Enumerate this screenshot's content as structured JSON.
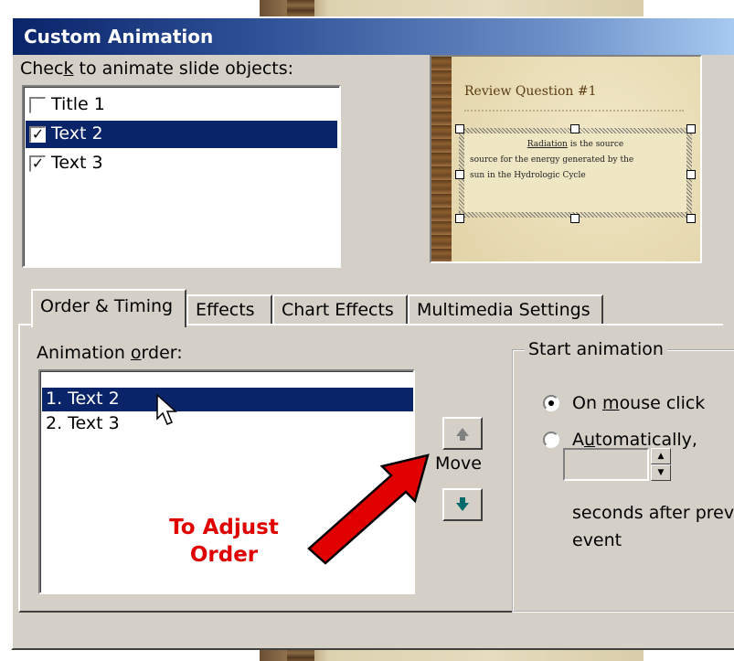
{
  "dialog": {
    "title": "Custom Animation",
    "objects_label_pre": "Chec",
    "objects_label_key": "k",
    "objects_label_post": " to animate slide objects:",
    "objects": [
      {
        "label": "Title 1",
        "checked": false,
        "selected": false
      },
      {
        "label": "Text 2",
        "checked": true,
        "selected": true
      },
      {
        "label": "Text 3",
        "checked": true,
        "selected": false
      }
    ],
    "preview": {
      "heading": "Review Question #1",
      "line1_word": "Radiation",
      "line1_tail": "is the source",
      "line2": "source for the energy generated by the",
      "line3": "sun in the Hydrologic Cycle"
    },
    "tabs": [
      {
        "label": "Order & Timing",
        "active": true
      },
      {
        "label": "Effects",
        "active": false
      },
      {
        "label": "Chart Effects",
        "active": false
      },
      {
        "label": "Multimedia Settings",
        "active": false
      }
    ],
    "order_label_pre": "Animation ",
    "order_label_key": "o",
    "order_label_post": "rder:",
    "order_items": [
      {
        "label": "1. Text 2",
        "selected": true
      },
      {
        "label": "2. Text 3",
        "selected": false
      }
    ],
    "move_label": "Move",
    "start_animation": {
      "legend": "Start animation",
      "on_click_pre": "On ",
      "on_click_key": "m",
      "on_click_post": "ouse click",
      "on_click_selected": true,
      "auto_pre": "A",
      "auto_key": "u",
      "auto_post": "tomatically,",
      "seconds_value": "",
      "seconds_text_1": "seconds after prev",
      "seconds_text_2": "event"
    }
  },
  "annotation": {
    "line1": "To Adjust",
    "line2": "Order",
    "color": "#e00000"
  }
}
